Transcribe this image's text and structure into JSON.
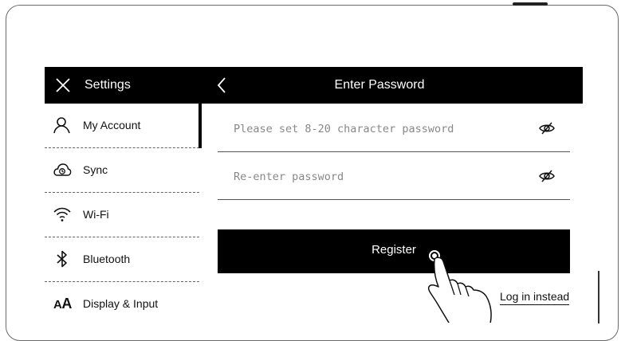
{
  "header": {
    "settings_title": "Settings",
    "page_title": "Enter Password"
  },
  "sidebar": {
    "items": [
      {
        "label": "My Account",
        "icon": "user-icon",
        "active": true
      },
      {
        "label": "Sync",
        "icon": "cloud-sync-icon",
        "active": false
      },
      {
        "label": "Wi-Fi",
        "icon": "wifi-icon",
        "active": false
      },
      {
        "label": "Bluetooth",
        "icon": "bluetooth-icon",
        "active": false
      },
      {
        "label": "Display & Input",
        "icon": "display-input-icon",
        "active": false
      }
    ]
  },
  "form": {
    "password": {
      "value": "",
      "placeholder": "Please set 8-20 character password"
    },
    "confirm_password": {
      "value": "",
      "placeholder": "Re-enter password"
    },
    "register_label": "Register",
    "login_label": "Log in instead"
  },
  "colors": {
    "bar": "#000000",
    "background": "#ffffff"
  }
}
